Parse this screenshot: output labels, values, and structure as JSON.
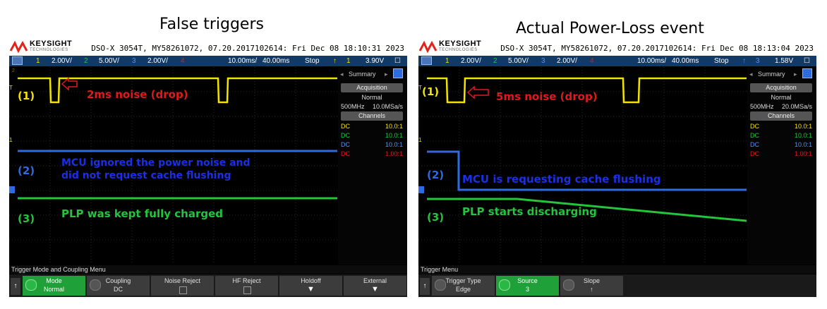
{
  "captions": {
    "left": "False triggers",
    "right": "Actual Power-Loss event"
  },
  "scope": {
    "brand": "KEYSIGHT",
    "brand_sub": "TECHNOLOGIES",
    "model_info": "DSO-X 3054T, MY58261072, 07.20.2017102614",
    "colors": {
      "ch1": "#f2e400",
      "ch2": "#22c53c",
      "ch3": "#2f6be0",
      "ch4": "#e01a1a",
      "softkey_on": "#1fa038"
    }
  },
  "left": {
    "datetime": "Fri Dec 08 18:10:31 2023",
    "bar": {
      "ch1": "1",
      "ch1_scale": "2.00V/",
      "ch2": "2",
      "ch2_scale": "5.00V/",
      "ch3": "3",
      "ch3_scale": "2.00V/",
      "ch4": "4",
      "timebase": "10.00ms/",
      "delay": "40.00ms",
      "state": "Stop",
      "trig_src": "1",
      "trig_level": "3.90V"
    },
    "side": {
      "tab": "Summary",
      "acq_header": "Acquisition",
      "mode": "Normal",
      "bw": "500MHz",
      "rate": "10.0MSa/s",
      "ch_header": "Channels",
      "channels": [
        {
          "coupling": "DC",
          "ratio": "10.0:1"
        },
        {
          "coupling": "DC",
          "ratio": "10.0:1"
        },
        {
          "coupling": "DC",
          "ratio": "10.0:1"
        },
        {
          "coupling": "DC",
          "ratio": "1.00:1"
        }
      ]
    },
    "menu_title": "Trigger Mode and Coupling Menu",
    "softkeys": [
      {
        "label": "Mode",
        "value": "Normal"
      },
      {
        "label": "Coupling",
        "value": "DC"
      },
      {
        "label": "Noise Reject",
        "value": ""
      },
      {
        "label": "HF Reject",
        "value": ""
      },
      {
        "label": "Holdoff",
        "value": ""
      },
      {
        "label": "External",
        "value": ""
      }
    ],
    "annotations": {
      "n1": "(1)",
      "n2": "(2)",
      "n3": "(3)",
      "a1": "2ms noise (drop)",
      "a2_line1": "MCU ignored the power noise and",
      "a2_line2": "did not request cache flushing",
      "a3": "PLP was kept fully charged"
    }
  },
  "right": {
    "datetime": "Fri Dec 08 18:13:04 2023",
    "bar": {
      "ch1": "1",
      "ch1_scale": "2.00V/",
      "ch2": "2",
      "ch2_scale": "5.00V/",
      "ch3": "3",
      "ch3_scale": "2.00V/",
      "ch4": "4",
      "timebase": "10.00ms/",
      "delay": "40.00ms",
      "state": "Stop",
      "trig_src": "3",
      "trig_level": "1.58V"
    },
    "side": {
      "tab": "Summary",
      "acq_header": "Acquisition",
      "mode": "Normal",
      "bw": "500MHz",
      "rate": "20.0MSa/s",
      "ch_header": "Channels",
      "channels": [
        {
          "coupling": "DC",
          "ratio": "10.0:1"
        },
        {
          "coupling": "DC",
          "ratio": "10.0:1"
        },
        {
          "coupling": "DC",
          "ratio": "10.0:1"
        },
        {
          "coupling": "DC",
          "ratio": "1.00:1"
        }
      ]
    },
    "menu_title": "Trigger Menu",
    "softkeys": [
      {
        "label": "Trigger Type",
        "value": "Edge"
      },
      {
        "label": "Source",
        "value": "3"
      },
      {
        "label": "Slope",
        "value": ""
      }
    ],
    "annotations": {
      "n1": "(1)",
      "n2": "(2)",
      "n3": "(3)",
      "a1": "5ms noise (drop)",
      "a2": "MCU is requesting cache flushing",
      "a3": "PLP starts discharging"
    }
  }
}
